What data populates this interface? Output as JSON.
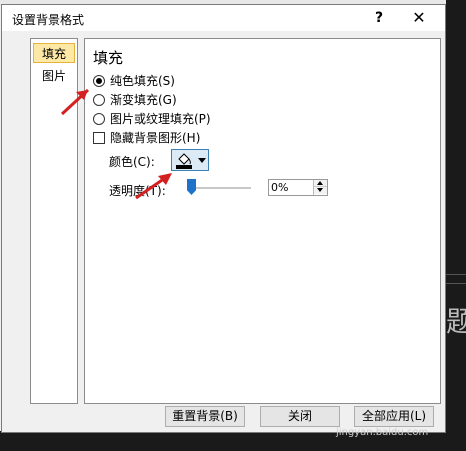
{
  "dialog": {
    "title": "设置背景格式",
    "help_label": "?",
    "close_label": "✕"
  },
  "nav": {
    "items": [
      {
        "label": "填充",
        "selected": true
      },
      {
        "label": "图片",
        "selected": false
      }
    ]
  },
  "fill": {
    "section_title": "填充",
    "options": [
      {
        "label": "纯色填充(S)",
        "checked": true
      },
      {
        "label": "渐变填充(G)",
        "checked": false
      },
      {
        "label": "图片或纹理填充(P)",
        "checked": false
      }
    ],
    "hide_graphics_label": "隐藏背景图形(H)",
    "color_label": "颜色(C):",
    "color_value": "#000000",
    "transparency_label": "透明度(T):",
    "transparency_value": "0%"
  },
  "buttons": {
    "reset": "重置背景(B)",
    "close": "关闭",
    "apply_all": "全部应用(L)"
  },
  "background": {
    "peek_text": "题"
  },
  "watermark": "jingyan.baidu.com",
  "colors": {
    "accent": "#2072c8",
    "nav_selected": "#fde8a6",
    "arrow": "#d42020"
  }
}
